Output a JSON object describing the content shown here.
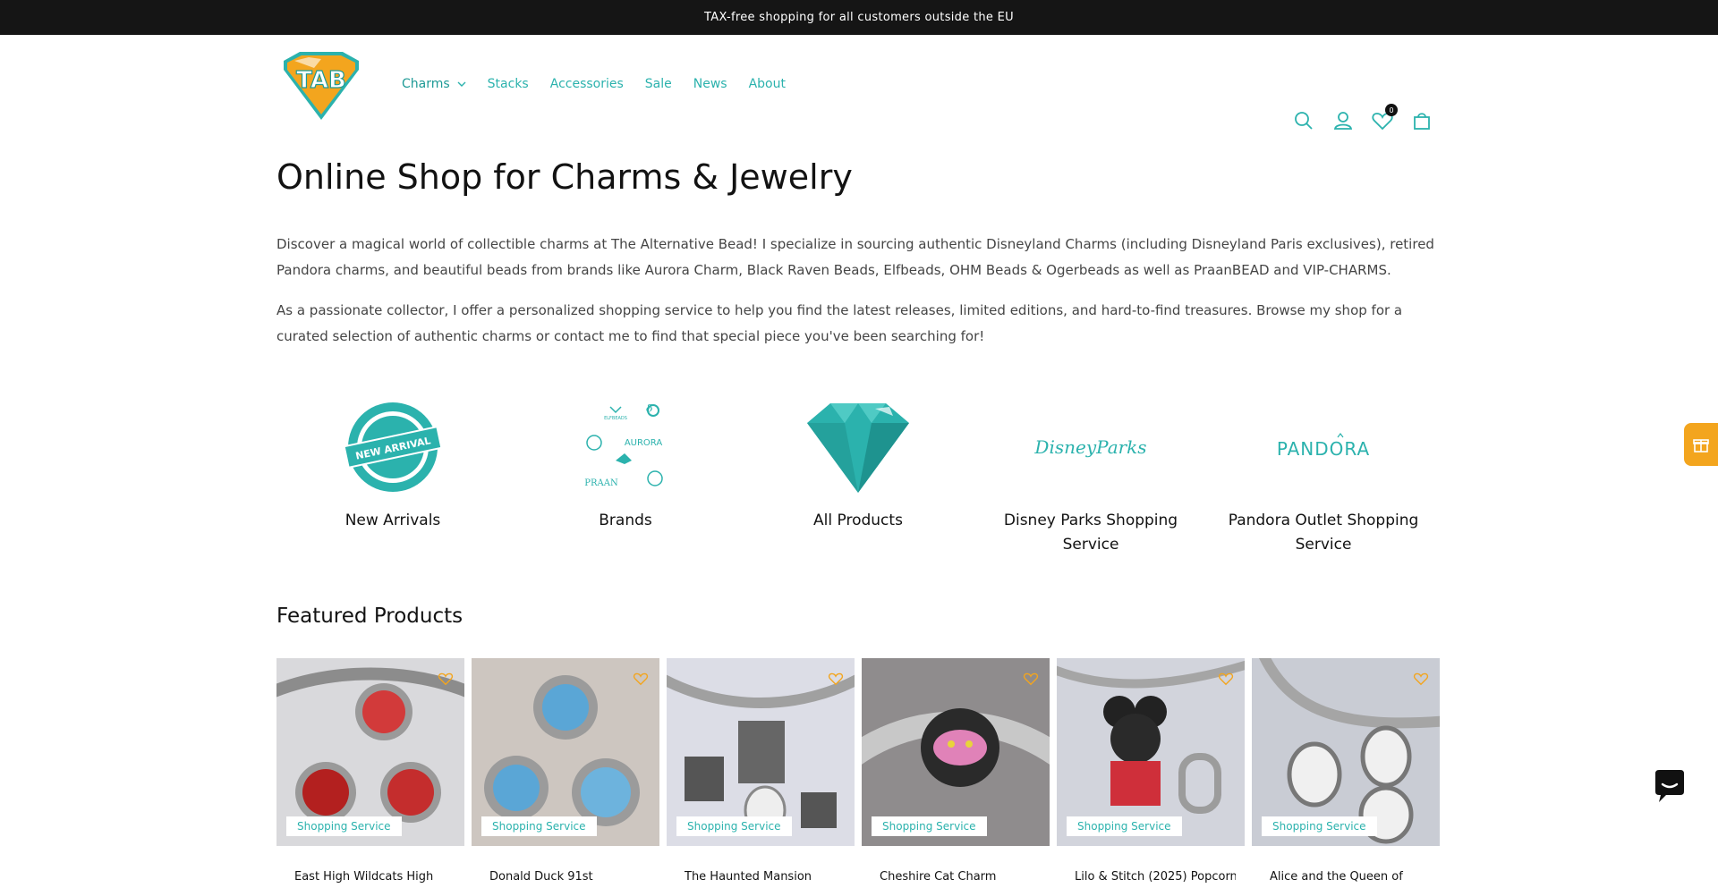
{
  "announcement": "TAX-free shopping for all customers outside the EU",
  "brand": {
    "logo_text": "TAB",
    "colors": {
      "accent": "#2bb2ad",
      "logo_orange": "#f3a51e",
      "announce_bg": "#151515",
      "badge_text": "#2bb2ad"
    }
  },
  "nav": {
    "items": [
      {
        "label": "Charms",
        "has_dropdown": true
      },
      {
        "label": "Stacks"
      },
      {
        "label": "Accessories"
      },
      {
        "label": "Sale"
      },
      {
        "label": "News"
      },
      {
        "label": "About"
      }
    ]
  },
  "header_icons": {
    "search": "search-icon",
    "account": "account-icon",
    "wishlist": "heart-icon",
    "wishlist_count": "0",
    "cart": "cart-icon"
  },
  "main": {
    "title": "Online Shop for Charms & Jewelry",
    "intro_1": "Discover a magical world of collectible charms at The Alternative Bead! I specialize in sourcing authentic Disneyland Charms (including Disneyland Paris exclusives), retired Pandora charms, and beautiful beads from brands like Aurora Charm, Black Raven Beads, Elfbeads, OHM Beads & Ogerbeads as well as PraanBEAD and VIP-CHARMS.",
    "intro_2": "As a passionate collector, I offer a personalized shopping service to help you find the latest releases, limited editions, and hard-to-find treasures. Browse my shop for a curated selection of authentic charms or contact me to find that special piece you've been searching for!"
  },
  "categories": [
    {
      "label": "New Arrivals",
      "badge_text": "NEW ARRIVAL"
    },
    {
      "label": "Brands",
      "logo_texts": [
        "ELFBEADS",
        "AURORA",
        "PRAAN"
      ]
    },
    {
      "label": "All Products"
    },
    {
      "label": "Disney Parks Shopping Service",
      "logo_text": "DisneyParks"
    },
    {
      "label": "Pandora Outlet Shopping Service",
      "logo_text": "PANDORA"
    }
  ],
  "featured": {
    "title": "Featured Products",
    "products": [
      {
        "name": "East High Wildcats High",
        "badge": "Shopping Service",
        "bg": "#d9d9dc"
      },
      {
        "name": "Donald Duck 91st",
        "badge": "Shopping Service",
        "bg": "#cdc6c0"
      },
      {
        "name": "The Haunted Mansion",
        "badge": "Shopping Service",
        "bg": "#dcdde6"
      },
      {
        "name": "Cheshire Cat Charm",
        "badge": "Shopping Service",
        "bg": "#8f8c8d"
      },
      {
        "name": "Lilo & Stitch (2025) Popcorn",
        "badge": "Shopping Service",
        "bg": "#d2d4dc"
      },
      {
        "name": "Alice and the Queen of",
        "badge": "Shopping Service",
        "bg": "#c9ccd4"
      }
    ]
  }
}
